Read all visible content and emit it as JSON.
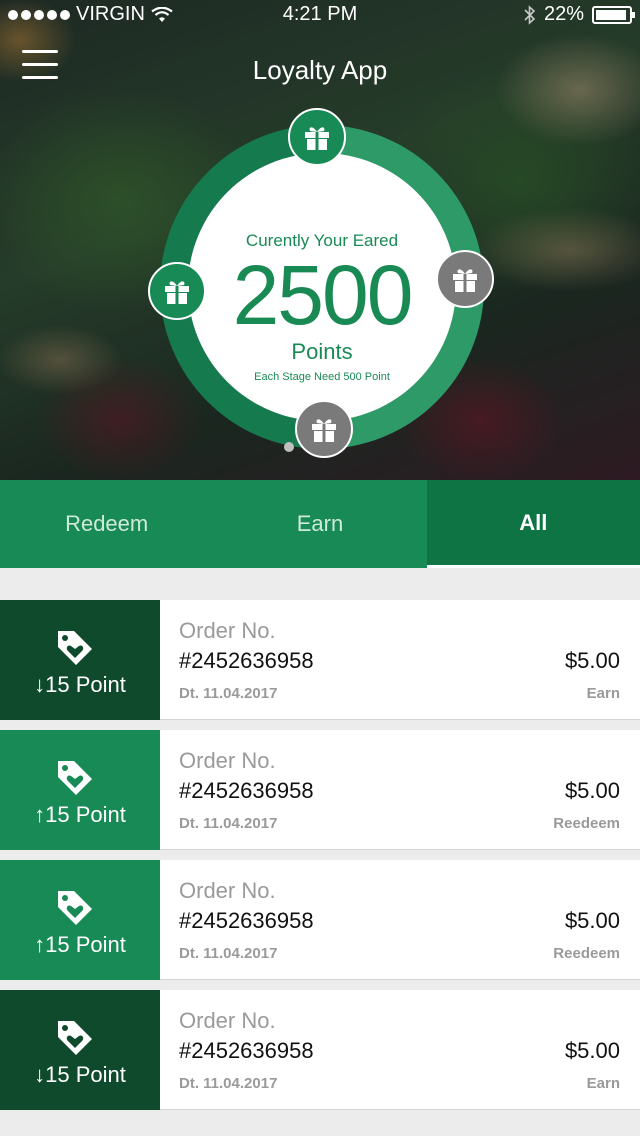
{
  "status": {
    "carrier": "VIRGIN",
    "time": "4:21 PM",
    "battery": "22%"
  },
  "header": {
    "title": "Loyalty App"
  },
  "points": {
    "caption": "Curently Your Eared",
    "value": "2500",
    "unit": "Points",
    "note": "Each Stage Need 500 Point"
  },
  "tabs": [
    {
      "label": "Redeem",
      "active": false
    },
    {
      "label": "Earn",
      "active": false
    },
    {
      "label": "All",
      "active": true
    }
  ],
  "colors": {
    "primary": "#178a55",
    "dark": "#0f4a2c",
    "active_tab": "#0f7444"
  },
  "transactions": [
    {
      "direction": "down",
      "arrow": "↓",
      "points": "15 Point",
      "label": "Order No.",
      "order": "#2452636958",
      "date": "Dt. 11.04.2017",
      "amount": "$5.00",
      "type": "Earn"
    },
    {
      "direction": "up",
      "arrow": "↑",
      "points": "15 Point",
      "label": "Order No.",
      "order": "#2452636958",
      "date": "Dt. 11.04.2017",
      "amount": "$5.00",
      "type": "Reedeem"
    },
    {
      "direction": "up",
      "arrow": "↑",
      "points": "15 Point",
      "label": "Order No.",
      "order": "#2452636958",
      "date": "Dt. 11.04.2017",
      "amount": "$5.00",
      "type": "Reedeem"
    },
    {
      "direction": "down",
      "arrow": "↓",
      "points": "15 Point",
      "label": "Order No.",
      "order": "#2452636958",
      "date": "Dt. 11.04.2017",
      "amount": "$5.00",
      "type": "Earn"
    }
  ]
}
